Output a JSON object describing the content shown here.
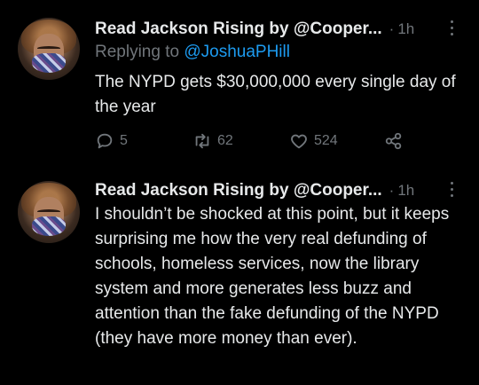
{
  "tweets": [
    {
      "author": "Read Jackson Rising by @Cooper...",
      "dot": "·",
      "time": "1h",
      "replying_prefix": "Replying to ",
      "replying_handle": "@JoshuaPHill",
      "text": "The NYPD gets $30,000,000 every single day of the year",
      "replies": "5",
      "retweets": "62",
      "likes": "524",
      "icons": [
        "reply-icon",
        "retweet-icon",
        "like-icon",
        "share-icon",
        "more-icon"
      ]
    },
    {
      "author": "Read Jackson Rising by @Cooper...",
      "dot": "·",
      "time": "1h",
      "text": "I shouldn’t be shocked at this point, but it keeps surprising me how the very real defunding of schools, homeless services, now the library system and more generates less buzz and attention than the fake defunding of the NYPD (they have more money than ever)."
    }
  ],
  "colors": {
    "background": "#000000",
    "text": "#e7e9ea",
    "muted": "#71767b",
    "link": "#1d9bf0"
  }
}
